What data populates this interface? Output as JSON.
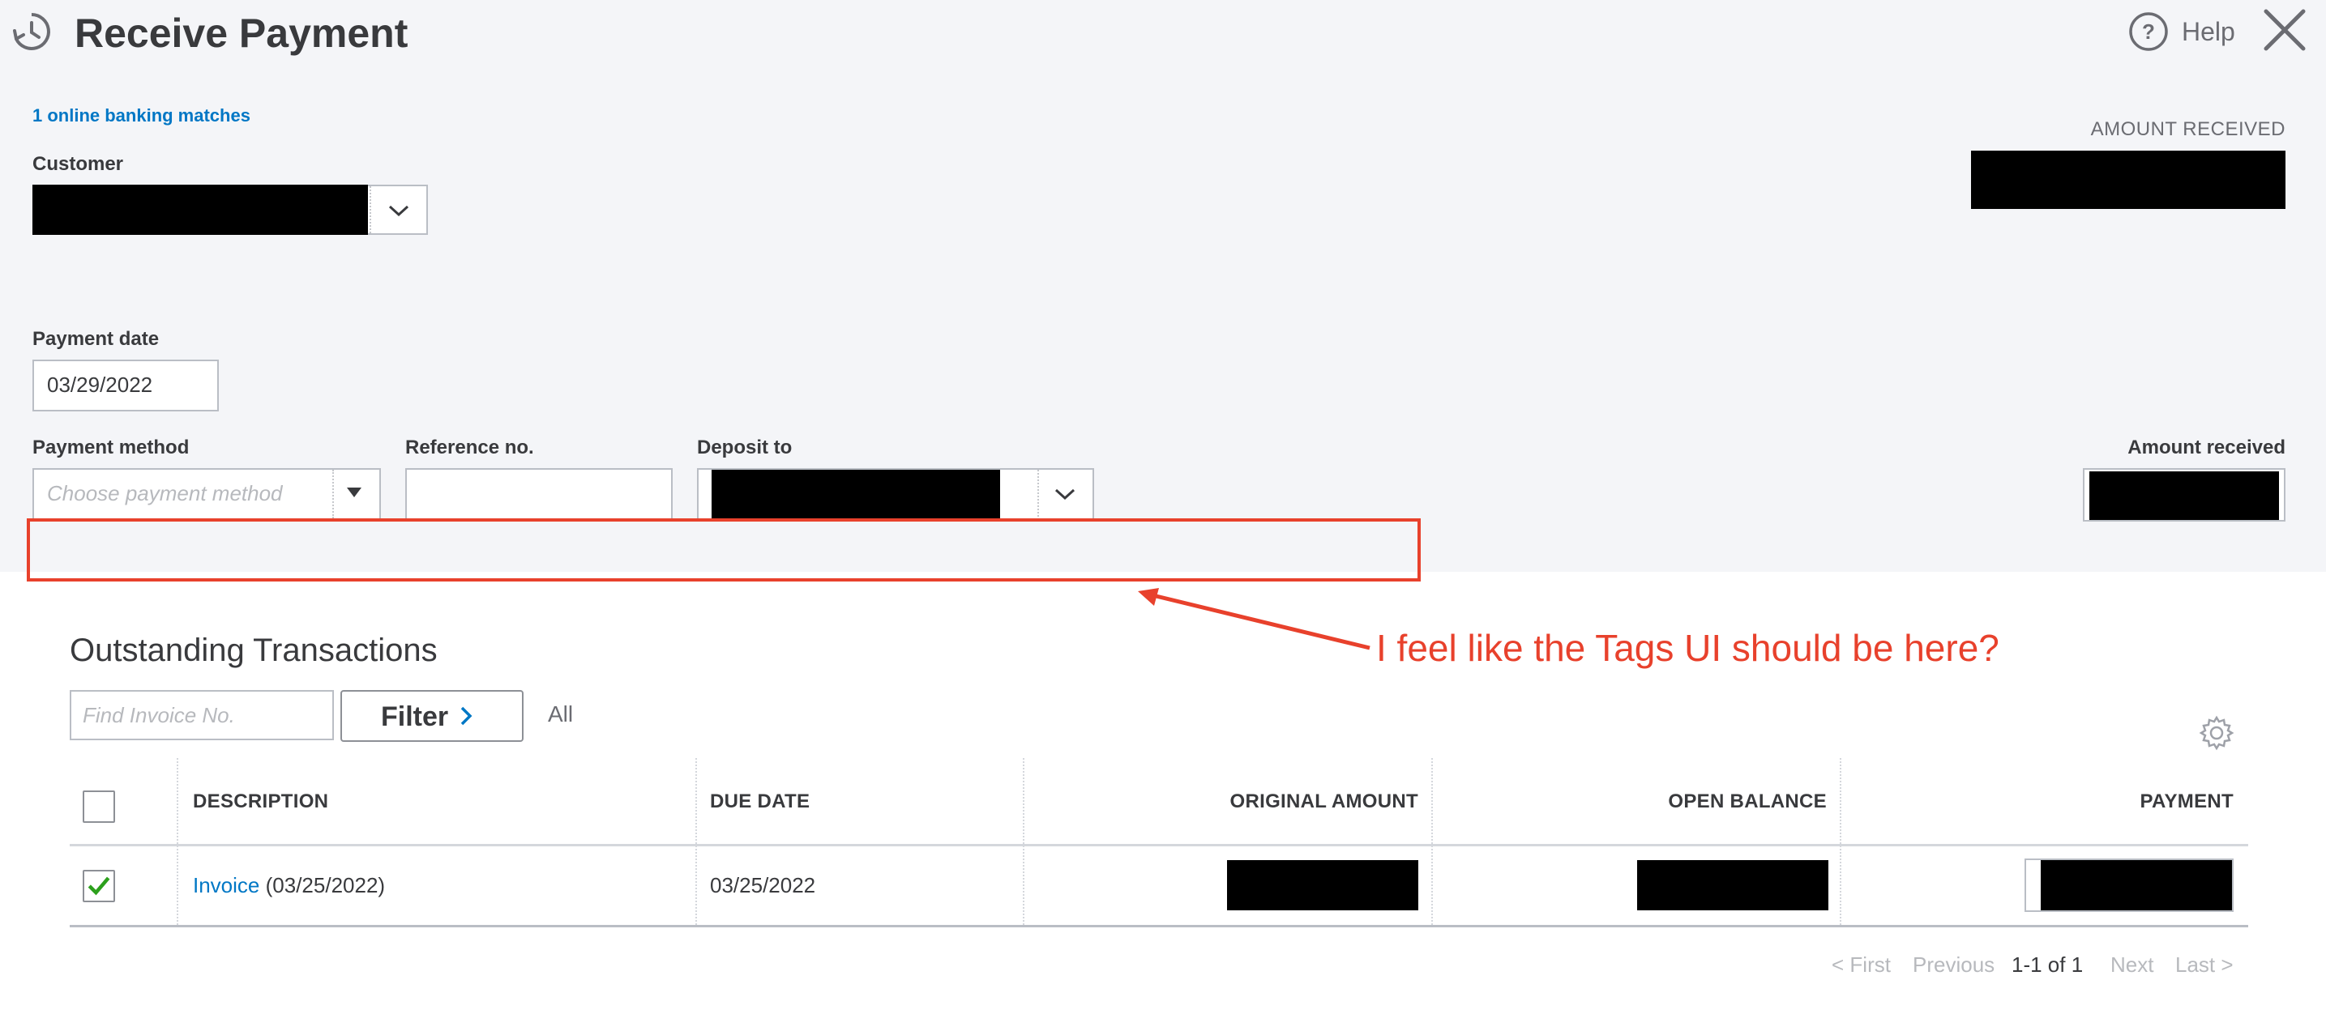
{
  "header": {
    "title": "Receive Payment",
    "help_label": "Help"
  },
  "form": {
    "banking_matches_link": "1 online banking matches",
    "customer_label": "Customer",
    "amount_received_header": "AMOUNT RECEIVED",
    "payment_date_label": "Payment date",
    "payment_date_value": "03/29/2022",
    "payment_method_label": "Payment method",
    "payment_method_placeholder": "Choose payment method",
    "reference_label": "Reference no.",
    "deposit_label": "Deposit to",
    "amount_received_label": "Amount received"
  },
  "annotation": {
    "text": "I feel like the Tags UI should be here?",
    "color": "#e8412c"
  },
  "transactions": {
    "title": "Outstanding Transactions",
    "find_placeholder": "Find Invoice No.",
    "filter_label": "Filter",
    "filter_value": "All",
    "columns": [
      "DESCRIPTION",
      "DUE DATE",
      "ORIGINAL AMOUNT",
      "OPEN BALANCE",
      "PAYMENT"
    ],
    "rows": [
      {
        "checked": true,
        "description_link": "Invoice",
        "description_date": "(03/25/2022)",
        "due_date": "03/25/2022"
      }
    ],
    "pagination": {
      "first": "< First",
      "previous": "Previous",
      "current": "1-1 of 1",
      "next": "Next",
      "last": "Last >"
    }
  },
  "colors": {
    "accent_link": "#0077c5",
    "check_green": "#2ca01c",
    "panel_bg": "#f4f5f8"
  },
  "icons": [
    "history-icon",
    "help-icon",
    "close-icon",
    "chevron-down-icon",
    "caret-down-icon",
    "chevron-right-icon",
    "gear-icon",
    "checkmark-icon"
  ]
}
